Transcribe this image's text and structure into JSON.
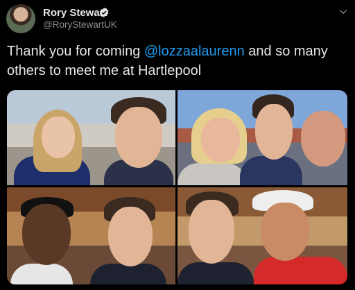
{
  "tweet": {
    "author": {
      "display_name": "Rory Stewart",
      "handle": "@RoryStewartUK",
      "verified": true
    },
    "text_before": "Thank you for coming ",
    "mention": "@lozzaalaurenn",
    "text_after": " and so many others to meet me at Hartlepool",
    "photo_count": 4
  },
  "colors": {
    "background": "#000000",
    "link": "#1d9bf0",
    "muted": "#8b8f95",
    "text": "#e7e7e7"
  },
  "icons": {
    "verified": "verified-badge-icon",
    "menu": "chevron-down-icon"
  }
}
